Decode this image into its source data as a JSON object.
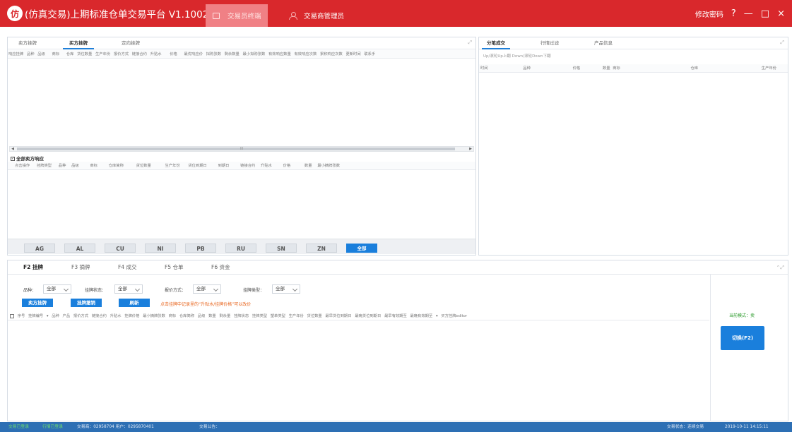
{
  "app": {
    "logo_text": "仿",
    "title": "(仿真交易)上期标准仓单交易平台 V1.1002.0"
  },
  "nav": {
    "tab_trader": "交易员终端",
    "tab_admin": "交易商管理员"
  },
  "window": {
    "change_password": "修改密码",
    "help": "?",
    "minimize": "—",
    "maximize": "□",
    "close": "×"
  },
  "left_top": {
    "tabs": [
      "卖方挂牌",
      "买方挂牌",
      "定向挂牌"
    ],
    "active_tab": "买方挂牌",
    "columns": [
      "响应挂牌",
      "品种",
      "品级",
      "商标",
      "仓库",
      "货位数量",
      "生产年份",
      "报价方式",
      "链接合约",
      "升贴水",
      "价格",
      "最优响应价",
      "拟购张数",
      "剩余数量",
      "最小拟购张数",
      "有效响应数量",
      "有效响应次数",
      "累积响应次数",
      "更新时间",
      "联系手"
    ],
    "scroll_mid": "III"
  },
  "left_mid": {
    "checkbox_label": "全部卖方响应",
    "checked": true,
    "columns": [
      "点击操作",
      "挂牌类型",
      "品种",
      "品级",
      "商标",
      "仓库简称",
      "货位数量",
      "生产年份",
      "货位到期日",
      "到期日",
      "链接合约",
      "升贴水",
      "价格",
      "数量",
      "最小摘牌张数"
    ]
  },
  "filters": {
    "items": [
      "AG",
      "AL",
      "CU",
      "NI",
      "PB",
      "RU",
      "SN",
      "ZN",
      "全部"
    ],
    "active": "全部"
  },
  "right": {
    "tabs": [
      "分笔成交",
      "行情过滤",
      "产品信息"
    ],
    "active_tab": "分笔成交",
    "hint": "Up/滚轮Up上翻 Down/滚轮Down下翻",
    "columns": [
      "时间",
      "品种",
      "价格",
      "数量",
      "商标",
      "仓库",
      "生产年份"
    ]
  },
  "bottom": {
    "tabs": [
      "F2 挂牌",
      "F3 摘牌",
      "F4 成交",
      "F5 仓单",
      "F6 资金"
    ],
    "active_tab": "F2 挂牌",
    "filters": [
      {
        "label": "品种：",
        "value": "全部"
      },
      {
        "label": "挂牌状态：",
        "value": "全部"
      },
      {
        "label": "报价方式：",
        "value": "全部"
      },
      {
        "label": "挂牌类型：",
        "value": "全部"
      }
    ],
    "buttons": {
      "sell_list": "卖方挂牌",
      "cancel_list": "挂牌撤销",
      "refresh": "刷新"
    },
    "hint": "点击挂牌中记录里的“升贴水/挂牌价格”可以改价",
    "columns": [
      "序号",
      "挂牌编号",
      "品种",
      "产品",
      "报价方式",
      "链接合约",
      "升贴水",
      "挂牌价格",
      "最小摘牌张数",
      "商标",
      "仓库简称",
      "品级",
      "数量",
      "剩余量",
      "挂牌状态",
      "挂牌类型",
      "塑单类型",
      "生产年份",
      "货位数量",
      "最早货位到期日",
      "最晚货位到期日",
      "最早有效期至",
      "最晚有效期至",
      "买方挂牌editor"
    ],
    "current_mode": "当前模式：卖",
    "switch_button": "切换(F2)"
  },
  "status": {
    "trade_login": "交易已登录",
    "market_login": "行情已登录",
    "account": "交易商：02958704 用户：0295870401",
    "notice": "交易公告：",
    "trade_status": "交易状态：连续交易",
    "datetime": "2019-10-11 14:15:11"
  },
  "colors": {
    "titlebar": "#d9282c",
    "accent": "#1a7fdc",
    "statusbar": "#2d6fb4",
    "hint": "#e8661f"
  }
}
